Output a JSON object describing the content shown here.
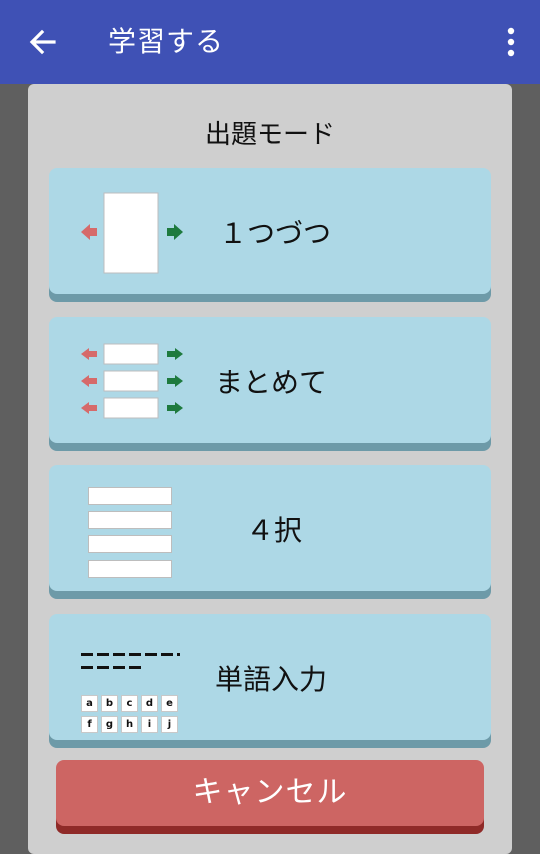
{
  "appbar": {
    "title": "学習する",
    "back_icon": "arrow-left-icon",
    "more_icon": "more-vertical-icon"
  },
  "dialog": {
    "title": "出題モード",
    "modes": [
      {
        "label": "１つづつ",
        "icon": "single-card-icon"
      },
      {
        "label": "まとめて",
        "icon": "stacked-cards-icon"
      },
      {
        "label": "４択",
        "icon": "four-choices-icon"
      },
      {
        "label": "単語入力",
        "icon": "word-input-icon"
      }
    ],
    "keyboard_keys": [
      "a",
      "b",
      "c",
      "d",
      "e",
      "f",
      "g",
      "h",
      "i",
      "j"
    ],
    "cancel_label": "キャンセル"
  },
  "colors": {
    "appbar": "#3f51b5",
    "card": "#add8e6",
    "card_shadow": "#6d9aa8",
    "cancel": "#cd6563",
    "arrow_left": "#d66a6a",
    "arrow_right": "#1e7a3e"
  }
}
